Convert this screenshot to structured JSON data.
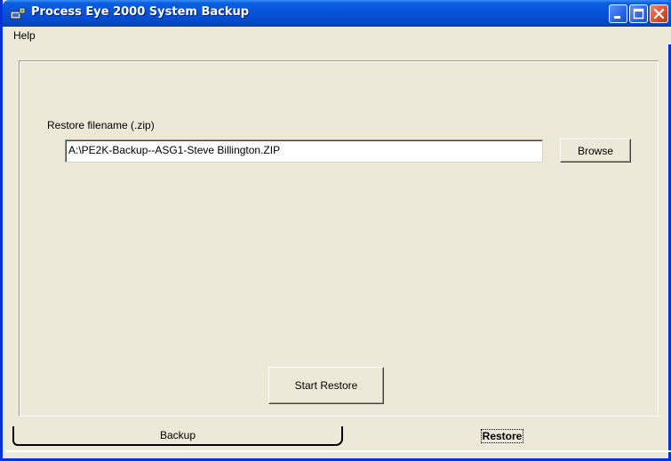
{
  "window": {
    "title": "Process Eye 2000 System Backup"
  },
  "menu": {
    "help_label": "Help"
  },
  "restore": {
    "filename_label": "Restore filename (.zip)",
    "filename_value": "A:\\PE2K-Backup--ASG1-Steve Billington.ZIP",
    "browse_label": "Browse",
    "start_label": "Start Restore"
  },
  "tabs": [
    {
      "label": "Backup",
      "selected": false
    },
    {
      "label": "Restore",
      "selected": true
    }
  ],
  "icons": {
    "app": "app-icon",
    "minimize": "minimize-icon",
    "maximize": "maximize-icon",
    "close": "close-icon"
  },
  "colors": {
    "titlebar": "#0652d8",
    "window_face": "#ece9d8",
    "close_button": "#d5512b"
  }
}
